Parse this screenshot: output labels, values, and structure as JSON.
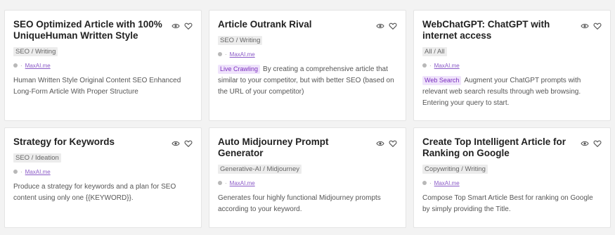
{
  "colors": {
    "accent": "#7b2fbf",
    "link": "#8a5ac7",
    "tag_bg": "#ececec"
  },
  "cards": [
    {
      "title": "SEO Optimized Article with 100% UniqueHuman Written Style",
      "tag": "SEO / Writing",
      "author": "MaxAI.me",
      "badge": "",
      "desc": "Human Written Style Original Content SEO Enhanced Long-Form Article With Proper Structure"
    },
    {
      "title": "Article Outrank Rival",
      "tag": "SEO / Writing",
      "author": "MaxAI.me",
      "badge": "Live Crawling",
      "desc": "By creating a comprehensive article that similar to your competitor, but with better SEO (based on the URL of your competitor)"
    },
    {
      "title": "WebChatGPT: ChatGPT with internet access",
      "tag": "All / All",
      "author": "MaxAI.me",
      "badge": "Web Search",
      "desc": "Augment your ChatGPT prompts with relevant web search results through web browsing. Entering your query to start."
    },
    {
      "title": "Strategy for Keywords",
      "tag": "SEO / Ideation",
      "author": "MaxAI.me",
      "badge": "",
      "desc": "Produce a strategy for keywords and a plan for SEO content using only one {{KEYWORD}}."
    },
    {
      "title": "Auto Midjourney Prompt Generator",
      "tag": "Generative-AI / Midjourney",
      "author": "MaxAI.me",
      "badge": "",
      "desc": "Generates four highly functional Midjourney prompts according to your keyword."
    },
    {
      "title": "Create Top Intelligent Article for Ranking on Google",
      "tag": "Copywriting / Writing",
      "author": "MaxAI.me",
      "badge": "",
      "desc": "Compose Top Smart Article Best for ranking on Google by simply providing the Title."
    }
  ]
}
